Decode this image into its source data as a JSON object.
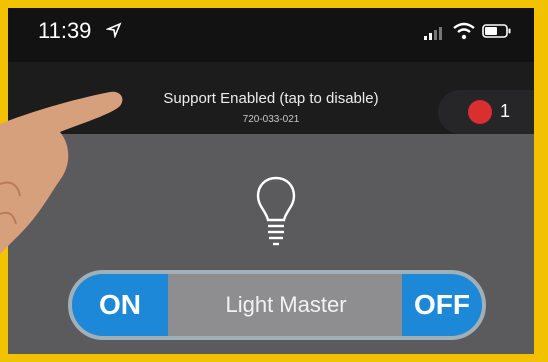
{
  "status_bar": {
    "time": "11:39",
    "icons": [
      "location-arrow-icon",
      "signal-icon",
      "wifi-icon",
      "battery-icon"
    ]
  },
  "support_banner": {
    "title": "Support Enabled (tap to disable)",
    "code": "720-033-021"
  },
  "alerts": {
    "count": "1",
    "color": "#d92f2f"
  },
  "main": {
    "icon": "lightbulb-icon",
    "toggle": {
      "on_label": "ON",
      "name": "Light Master",
      "off_label": "OFF",
      "accent": "#1e88d8"
    }
  },
  "colors": {
    "frame": "#f2c200",
    "screen_bg": "#5b5b5e",
    "topbar": "#121212"
  }
}
